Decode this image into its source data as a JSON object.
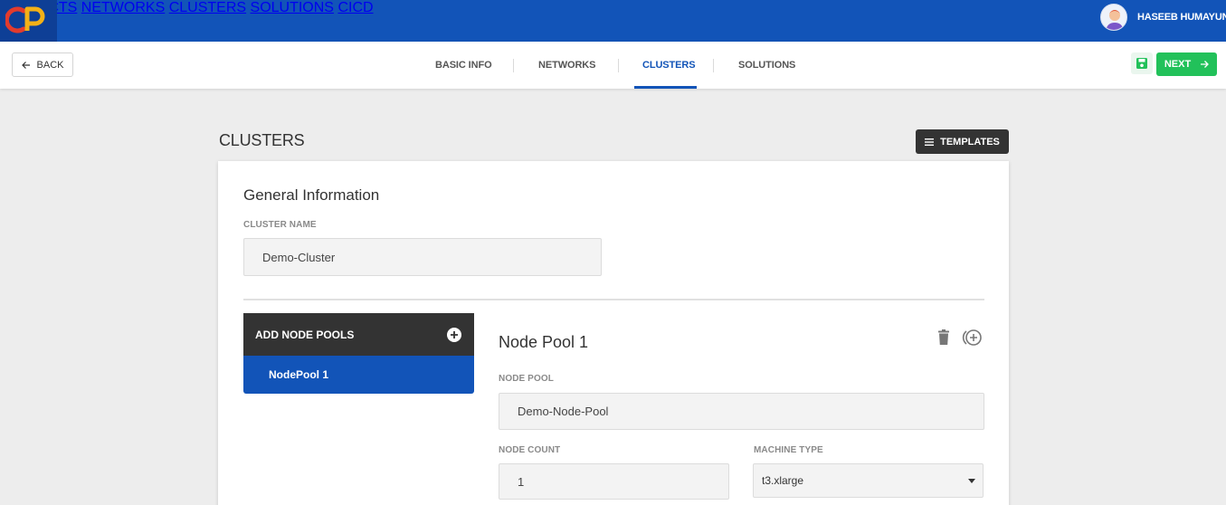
{
  "app": {
    "logo_text": "CP"
  },
  "topnav": {
    "items": [
      "PROJECTS",
      "NETWORKS",
      "CLUSTERS",
      "SOLUTIONS",
      "CICD"
    ],
    "user_name": "HASEEB HUMAYUN"
  },
  "subbar": {
    "back_label": "BACK",
    "steps": [
      "BASIC INFO",
      "NETWORKS",
      "CLUSTERS",
      "SOLUTIONS"
    ],
    "active_step": "CLUSTERS",
    "next_label": "NEXT"
  },
  "page": {
    "title": "CLUSTERS",
    "templates_label": "TEMPLATES"
  },
  "general": {
    "title": "General Information",
    "cluster_name_label": "CLUSTER NAME",
    "cluster_name_value": "Demo-Cluster"
  },
  "node_pools": {
    "header": "ADD NODE POOLS",
    "items": [
      "NodePool 1"
    ]
  },
  "node_pool": {
    "title": "Node Pool 1",
    "pool_label": "NODE POOL",
    "pool_value": "Demo-Node-Pool",
    "count_label": "NODE COUNT",
    "count_value": "1",
    "machine_label": "MACHINE TYPE",
    "machine_value": "t3.xlarge"
  },
  "colors": {
    "brand_blue": "#1254b8",
    "dark": "#333333",
    "success_green": "#22c15a"
  }
}
